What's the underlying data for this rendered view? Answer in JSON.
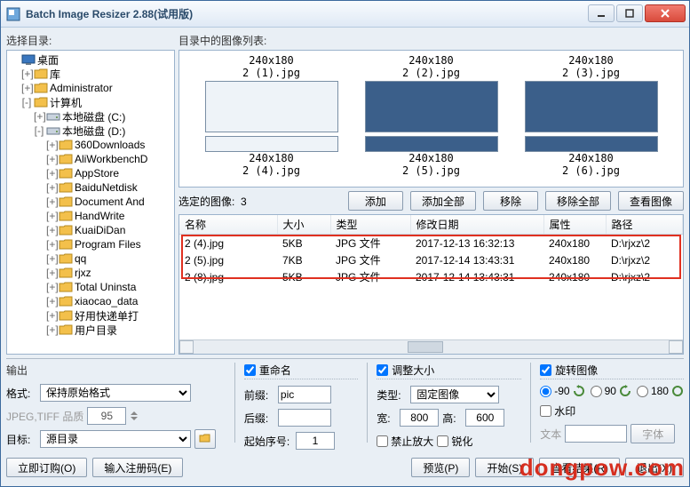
{
  "window": {
    "title": "Batch Image Resizer 2.88(试用版)"
  },
  "labels": {
    "select_dir": "选择目录:",
    "dir_list": "目录中的图像列表:",
    "selected_images": "选定的图像:",
    "selected_count": "3",
    "output": "输出",
    "format": "格式:",
    "jpeg_quality": "JPEG,TIFF 品质",
    "target": "目标:",
    "rename": "重命名",
    "prefix": "前缀:",
    "suffix": "后缀:",
    "start_num": "起始序号:",
    "adjust_size": "调整大小",
    "type": "类型:",
    "width": "宽:",
    "height": "高:",
    "no_enlarge": "禁止放大",
    "sharpen": "锐化",
    "rotate": "旋转图像",
    "watermark": "水印",
    "text": "文本"
  },
  "tree": [
    {
      "indent": 0,
      "twisty": "",
      "icon": "desk",
      "label": "桌面"
    },
    {
      "indent": 1,
      "twisty": "+",
      "icon": "folder",
      "label": "库"
    },
    {
      "indent": 1,
      "twisty": "+",
      "icon": "folder",
      "label": "Administrator"
    },
    {
      "indent": 1,
      "twisty": "-",
      "icon": "folder",
      "label": "计算机"
    },
    {
      "indent": 2,
      "twisty": "+",
      "icon": "drive",
      "label": "本地磁盘 (C:)"
    },
    {
      "indent": 2,
      "twisty": "-",
      "icon": "drive",
      "label": "本地磁盘 (D:)"
    },
    {
      "indent": 3,
      "twisty": "+",
      "icon": "folder",
      "label": "360Downloads"
    },
    {
      "indent": 3,
      "twisty": "+",
      "icon": "folder",
      "label": "AliWorkbenchD"
    },
    {
      "indent": 3,
      "twisty": "+",
      "icon": "folder",
      "label": "AppStore"
    },
    {
      "indent": 3,
      "twisty": "+",
      "icon": "folder",
      "label": "BaiduNetdisk"
    },
    {
      "indent": 3,
      "twisty": "+",
      "icon": "folder",
      "label": "Document And"
    },
    {
      "indent": 3,
      "twisty": "+",
      "icon": "folder",
      "label": "HandWrite"
    },
    {
      "indent": 3,
      "twisty": "+",
      "icon": "folder",
      "label": "KuaiDiDan"
    },
    {
      "indent": 3,
      "twisty": "+",
      "icon": "folder",
      "label": "Program Files"
    },
    {
      "indent": 3,
      "twisty": "+",
      "icon": "folder",
      "label": "qq"
    },
    {
      "indent": 3,
      "twisty": "+",
      "icon": "folder",
      "label": "rjxz"
    },
    {
      "indent": 3,
      "twisty": "+",
      "icon": "folder",
      "label": "Total Uninsta"
    },
    {
      "indent": 3,
      "twisty": "+",
      "icon": "folder",
      "label": "xiaocao_data"
    },
    {
      "indent": 3,
      "twisty": "+",
      "icon": "folder",
      "label": "好用快递单打"
    },
    {
      "indent": 3,
      "twisty": "+",
      "icon": "folder",
      "label": "用户目录"
    }
  ],
  "thumbs": [
    {
      "dim": "240x180",
      "name": "2 (1).jpg",
      "style": "light"
    },
    {
      "dim": "240x180",
      "name": "2 (2).jpg",
      "style": "dark"
    },
    {
      "dim": "240x180",
      "name": "2 (3).jpg",
      "style": "dark"
    },
    {
      "dim": "240x180",
      "name": "2 (4).jpg",
      "style": "light"
    },
    {
      "dim": "240x180",
      "name": "2 (5).jpg",
      "style": "dark"
    },
    {
      "dim": "240x180",
      "name": "2 (6).jpg",
      "style": "dark"
    }
  ],
  "buttons": {
    "add": "添加",
    "add_all": "添加全部",
    "remove": "移除",
    "remove_all": "移除全部",
    "view_image": "查看图像",
    "order_now": "立即订购(O)",
    "enter_reg": "输入注册码(E)",
    "preview": "预览(P)",
    "start": "开始(S)",
    "view_result": "查看结果(R)",
    "exit": "退出(X)",
    "font": "字体"
  },
  "list": {
    "headers": {
      "name": "名称",
      "size": "大小",
      "type": "类型",
      "modified": "修改日期",
      "attr": "属性",
      "path": "路径"
    },
    "rows": [
      {
        "name": "2 (4).jpg",
        "size": "5KB",
        "type": "JPG 文件",
        "modified": "2017-12-13 16:32:13",
        "attr": "240x180",
        "path": "D:\\rjxz\\2"
      },
      {
        "name": "2 (5).jpg",
        "size": "7KB",
        "type": "JPG 文件",
        "modified": "2017-12-14 13:43:31",
        "attr": "240x180",
        "path": "D:\\rjxz\\2"
      },
      {
        "name": "2 (8).jpg",
        "size": "5KB",
        "type": "JPG 文件",
        "modified": "2017-12-14 13:43:31",
        "attr": "240x180",
        "path": "D:\\rjxz\\2"
      }
    ]
  },
  "output": {
    "format_value": "保持原始格式",
    "quality_value": "95",
    "target_value": "源目录",
    "prefix_value": "pic",
    "suffix_value": "",
    "startnum_value": "1",
    "type_value": "固定图像",
    "width_value": "800",
    "height_value": "600",
    "rot_neg90": "-90",
    "rot_90": "90",
    "rot_180": "180"
  },
  "watermark_text": "dongpow.com"
}
